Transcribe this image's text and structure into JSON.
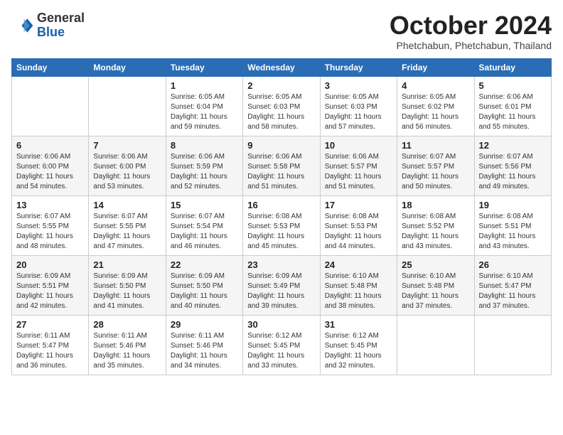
{
  "header": {
    "logo_general": "General",
    "logo_blue": "Blue",
    "month_title": "October 2024",
    "location": "Phetchabun, Phetchabun, Thailand"
  },
  "days_of_week": [
    "Sunday",
    "Monday",
    "Tuesday",
    "Wednesday",
    "Thursday",
    "Friday",
    "Saturday"
  ],
  "weeks": [
    [
      {
        "day": "",
        "info": ""
      },
      {
        "day": "",
        "info": ""
      },
      {
        "day": "1",
        "info": "Sunrise: 6:05 AM\nSunset: 6:04 PM\nDaylight: 11 hours and 59 minutes."
      },
      {
        "day": "2",
        "info": "Sunrise: 6:05 AM\nSunset: 6:03 PM\nDaylight: 11 hours and 58 minutes."
      },
      {
        "day": "3",
        "info": "Sunrise: 6:05 AM\nSunset: 6:03 PM\nDaylight: 11 hours and 57 minutes."
      },
      {
        "day": "4",
        "info": "Sunrise: 6:05 AM\nSunset: 6:02 PM\nDaylight: 11 hours and 56 minutes."
      },
      {
        "day": "5",
        "info": "Sunrise: 6:06 AM\nSunset: 6:01 PM\nDaylight: 11 hours and 55 minutes."
      }
    ],
    [
      {
        "day": "6",
        "info": "Sunrise: 6:06 AM\nSunset: 6:00 PM\nDaylight: 11 hours and 54 minutes."
      },
      {
        "day": "7",
        "info": "Sunrise: 6:06 AM\nSunset: 6:00 PM\nDaylight: 11 hours and 53 minutes."
      },
      {
        "day": "8",
        "info": "Sunrise: 6:06 AM\nSunset: 5:59 PM\nDaylight: 11 hours and 52 minutes."
      },
      {
        "day": "9",
        "info": "Sunrise: 6:06 AM\nSunset: 5:58 PM\nDaylight: 11 hours and 51 minutes."
      },
      {
        "day": "10",
        "info": "Sunrise: 6:06 AM\nSunset: 5:57 PM\nDaylight: 11 hours and 51 minutes."
      },
      {
        "day": "11",
        "info": "Sunrise: 6:07 AM\nSunset: 5:57 PM\nDaylight: 11 hours and 50 minutes."
      },
      {
        "day": "12",
        "info": "Sunrise: 6:07 AM\nSunset: 5:56 PM\nDaylight: 11 hours and 49 minutes."
      }
    ],
    [
      {
        "day": "13",
        "info": "Sunrise: 6:07 AM\nSunset: 5:55 PM\nDaylight: 11 hours and 48 minutes."
      },
      {
        "day": "14",
        "info": "Sunrise: 6:07 AM\nSunset: 5:55 PM\nDaylight: 11 hours and 47 minutes."
      },
      {
        "day": "15",
        "info": "Sunrise: 6:07 AM\nSunset: 5:54 PM\nDaylight: 11 hours and 46 minutes."
      },
      {
        "day": "16",
        "info": "Sunrise: 6:08 AM\nSunset: 5:53 PM\nDaylight: 11 hours and 45 minutes."
      },
      {
        "day": "17",
        "info": "Sunrise: 6:08 AM\nSunset: 5:53 PM\nDaylight: 11 hours and 44 minutes."
      },
      {
        "day": "18",
        "info": "Sunrise: 6:08 AM\nSunset: 5:52 PM\nDaylight: 11 hours and 43 minutes."
      },
      {
        "day": "19",
        "info": "Sunrise: 6:08 AM\nSunset: 5:51 PM\nDaylight: 11 hours and 43 minutes."
      }
    ],
    [
      {
        "day": "20",
        "info": "Sunrise: 6:09 AM\nSunset: 5:51 PM\nDaylight: 11 hours and 42 minutes."
      },
      {
        "day": "21",
        "info": "Sunrise: 6:09 AM\nSunset: 5:50 PM\nDaylight: 11 hours and 41 minutes."
      },
      {
        "day": "22",
        "info": "Sunrise: 6:09 AM\nSunset: 5:50 PM\nDaylight: 11 hours and 40 minutes."
      },
      {
        "day": "23",
        "info": "Sunrise: 6:09 AM\nSunset: 5:49 PM\nDaylight: 11 hours and 39 minutes."
      },
      {
        "day": "24",
        "info": "Sunrise: 6:10 AM\nSunset: 5:48 PM\nDaylight: 11 hours and 38 minutes."
      },
      {
        "day": "25",
        "info": "Sunrise: 6:10 AM\nSunset: 5:48 PM\nDaylight: 11 hours and 37 minutes."
      },
      {
        "day": "26",
        "info": "Sunrise: 6:10 AM\nSunset: 5:47 PM\nDaylight: 11 hours and 37 minutes."
      }
    ],
    [
      {
        "day": "27",
        "info": "Sunrise: 6:11 AM\nSunset: 5:47 PM\nDaylight: 11 hours and 36 minutes."
      },
      {
        "day": "28",
        "info": "Sunrise: 6:11 AM\nSunset: 5:46 PM\nDaylight: 11 hours and 35 minutes."
      },
      {
        "day": "29",
        "info": "Sunrise: 6:11 AM\nSunset: 5:46 PM\nDaylight: 11 hours and 34 minutes."
      },
      {
        "day": "30",
        "info": "Sunrise: 6:12 AM\nSunset: 5:45 PM\nDaylight: 11 hours and 33 minutes."
      },
      {
        "day": "31",
        "info": "Sunrise: 6:12 AM\nSunset: 5:45 PM\nDaylight: 11 hours and 32 minutes."
      },
      {
        "day": "",
        "info": ""
      },
      {
        "day": "",
        "info": ""
      }
    ]
  ]
}
